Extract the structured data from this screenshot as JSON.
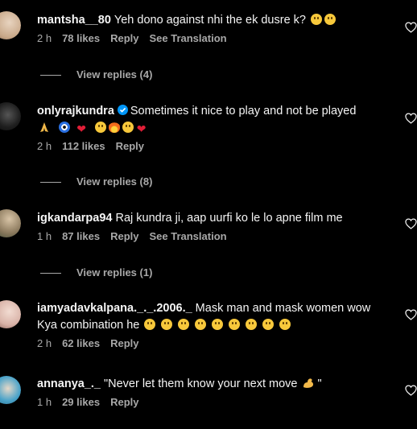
{
  "comments": [
    {
      "username": "mantsha__80",
      "text": "Yeh dono against nhi the ek dusre k?",
      "time": "2 h",
      "likes": "78 likes",
      "reply": "Reply",
      "translate": "See Translation",
      "view_replies": "View replies (4)",
      "avatar_color": "#c9a98a"
    },
    {
      "username": "onlyrajkundra",
      "text_line1": "Sometimes it nice to play and not be played",
      "time": "2 h",
      "likes": "112 likes",
      "reply": "Reply",
      "view_replies": "View replies (8)",
      "avatar_color": "#2b2b2b"
    },
    {
      "username": "igkandarpa94",
      "text": "Raj kundra ji, aap uurfi ko le lo apne film me",
      "time": "1 h",
      "likes": "87 likes",
      "reply": "Reply",
      "translate": "See Translation",
      "view_replies": "View replies (1)",
      "avatar_color": "#8c7a5e"
    },
    {
      "username": "iamyadavkalpana._._.2006._",
      "text_line1": "Mask man and mask women wow",
      "text_line2": "Kya combination he",
      "time": "2 h",
      "likes": "62 likes",
      "reply": "Reply",
      "avatar_color": "#d9b3a8"
    },
    {
      "username": "annanya_._",
      "text": "\"Never let them know your next move",
      "text_end": "\"",
      "time": "1 h",
      "likes": "29 likes",
      "reply": "Reply",
      "avatar_color": "#4aa3c9"
    }
  ],
  "icons": {
    "like": "heart-outline-icon",
    "verified": "verified-badge-icon"
  },
  "colors": {
    "background": "#000000",
    "text": "#f5f5f5",
    "secondary": "#a8a8a8",
    "verified": "#0095f6"
  }
}
